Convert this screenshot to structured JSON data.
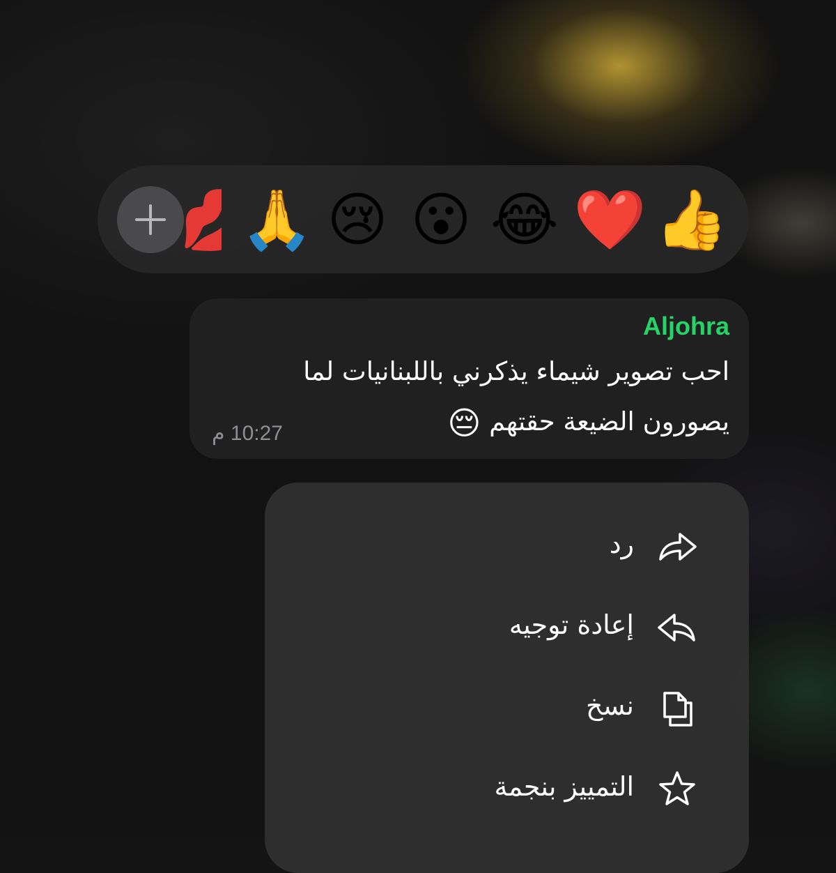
{
  "reactions": {
    "add_label": "+",
    "items": [
      {
        "name": "thumbs-up",
        "glyph": "👍"
      },
      {
        "name": "red-heart",
        "glyph": "❤️"
      },
      {
        "name": "tears-of-joy",
        "glyph": "😂"
      },
      {
        "name": "surprised-face",
        "glyph": "😮"
      },
      {
        "name": "crying-face",
        "glyph": "😢"
      },
      {
        "name": "folded-hands",
        "glyph": "🙏"
      },
      {
        "name": "kiss-mark",
        "glyph": "💋"
      }
    ]
  },
  "message": {
    "sender": "Aljohra",
    "sender_color": "#25d366",
    "line1": "احب تصوير شيماء يذكرني باللبنانيات لما",
    "line2": "يصورون الضيعة حقتهم",
    "line2_emoji": "😔",
    "time": "10:27 م"
  },
  "menu": {
    "items": [
      {
        "label": "رد",
        "icon": "reply-icon"
      },
      {
        "label": "إعادة توجيه",
        "icon": "forward-icon"
      },
      {
        "label": "نسخ",
        "icon": "copy-icon"
      },
      {
        "label": "التمييز بنجمة",
        "icon": "star-icon"
      }
    ]
  }
}
